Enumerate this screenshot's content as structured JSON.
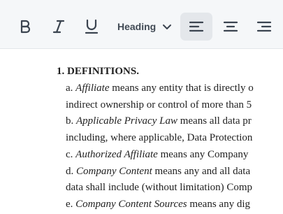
{
  "toolbar": {
    "heading_select_value": "Heading"
  },
  "document": {
    "section_number": "1.",
    "section_title": "DEFINITIONS.",
    "lines": [
      {
        "prefix": "a. ",
        "term": "Affiliate",
        "rest": " means any entity that is directly o"
      },
      {
        "prefix": "",
        "term": "",
        "rest": "indirect ownership or control of more than 5"
      },
      {
        "prefix": "b. ",
        "term": "Applicable Privacy Law",
        "rest": " means all data pr"
      },
      {
        "prefix": "",
        "term": "",
        "rest": "including, where applicable, Data Protection"
      },
      {
        "prefix": "c. ",
        "term": "Authorized Affiliate",
        "rest": " means any Company"
      },
      {
        "prefix": "d. ",
        "term": "Company Content",
        "rest": " means any and all data"
      },
      {
        "prefix": "",
        "term": "",
        "rest": "data shall include (without limitation) Comp"
      },
      {
        "prefix": "e. ",
        "term": "Company Content Sources",
        "rest": " means any dig"
      }
    ]
  }
}
